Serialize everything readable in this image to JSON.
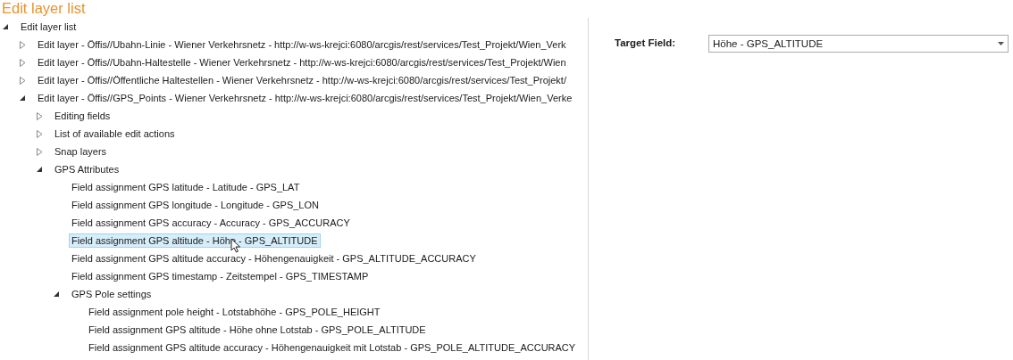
{
  "title": "Edit layer list",
  "tree": [
    {
      "label": "Edit layer list",
      "kind": "group",
      "expanded": true,
      "selected": false,
      "children": [
        {
          "label": "Edit layer - Öffis//Ubahn-Linie - Wiener Verkehrsnetz - http://w-ws-krejci:6080/arcgis/rest/services/Test_Projekt/Wien_Verk",
          "kind": "group",
          "expanded": false,
          "selected": false
        },
        {
          "label": "Edit layer - Öffis//Ubahn-Haltestelle - Wiener Verkehrsnetz - http://w-ws-krejci:6080/arcgis/rest/services/Test_Projekt/Wien",
          "kind": "group",
          "expanded": false,
          "selected": false
        },
        {
          "label": "Edit layer - Öffis//Öffentliche Haltestellen - Wiener Verkehrsnetz - http://w-ws-krejci:6080/arcgis/rest/services/Test_Projekt/",
          "kind": "group",
          "expanded": false,
          "selected": false
        },
        {
          "label": "Edit layer - Öffis//GPS_Points - Wiener Verkehrsnetz - http://w-ws-krejci:6080/arcgis/rest/services/Test_Projekt/Wien_Verke",
          "kind": "group",
          "expanded": true,
          "selected": false,
          "children": [
            {
              "label": "Editing fields",
              "kind": "group",
              "expanded": false,
              "selected": false
            },
            {
              "label": "List of available edit actions",
              "kind": "group",
              "expanded": false,
              "selected": false
            },
            {
              "label": "Snap layers",
              "kind": "group",
              "expanded": false,
              "selected": false
            },
            {
              "label": "GPS Attributes",
              "kind": "group",
              "expanded": true,
              "selected": false,
              "children": [
                {
                  "label": "Field assignment GPS latitude - Latitude - GPS_LAT",
                  "kind": "field",
                  "selected": false
                },
                {
                  "label": "Field assignment GPS longitude - Longitude - GPS_LON",
                  "kind": "field",
                  "selected": false
                },
                {
                  "label": "Field assignment GPS accuracy - Accuracy - GPS_ACCURACY",
                  "kind": "field",
                  "selected": false
                },
                {
                  "label": "Field assignment GPS altitude - Höhe - GPS_ALTITUDE",
                  "kind": "field",
                  "selected": true
                },
                {
                  "label": "Field assignment GPS altitude accuracy - Höhengenauigkeit - GPS_ALTITUDE_ACCURACY",
                  "kind": "field",
                  "selected": false
                },
                {
                  "label": "Field assignment GPS timestamp - Zeitstempel - GPS_TIMESTAMP",
                  "kind": "field",
                  "selected": false
                },
                {
                  "label": "GPS Pole settings",
                  "kind": "group",
                  "expanded": true,
                  "selected": false,
                  "children": [
                    {
                      "label": "Field assignment pole height - Lotstabhöhe - GPS_POLE_HEIGHT",
                      "kind": "field",
                      "selected": false
                    },
                    {
                      "label": "Field assignment GPS altitude - Höhe ohne Lotstab - GPS_POLE_ALTITUDE",
                      "kind": "field",
                      "selected": false
                    },
                    {
                      "label": "Field assignment GPS altitude accuracy - Höhengenauigkeit mit Lotstab - GPS_POLE_ALTITUDE_ACCURACY",
                      "kind": "field",
                      "selected": false
                    }
                  ]
                }
              ]
            }
          ]
        }
      ]
    }
  ],
  "target_field": {
    "label": "Target Field:",
    "value": "Höhe - GPS_ALTITUDE"
  }
}
